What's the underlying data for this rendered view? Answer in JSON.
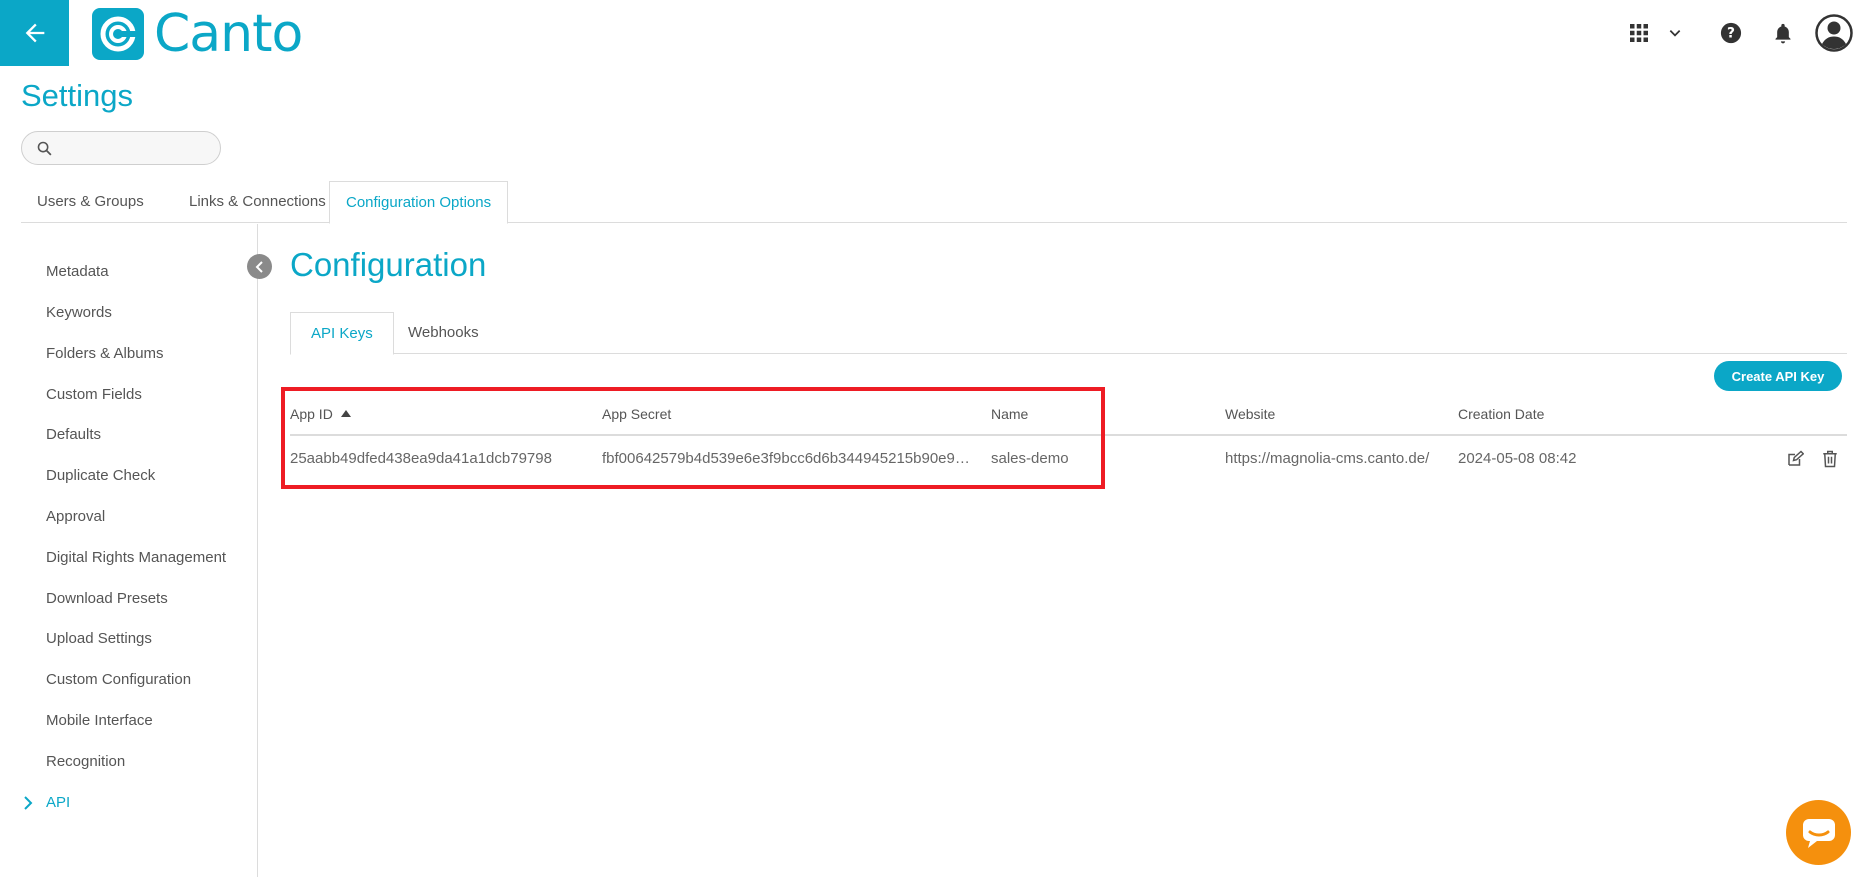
{
  "header": {
    "logo_text": "Canto",
    "brand_color": "#0ba7c7",
    "icons": [
      "arrow-left-icon",
      "apps-grid-icon",
      "chevron-down-icon",
      "help-icon",
      "bell-icon",
      "user-avatar-icon"
    ]
  },
  "page": {
    "title": "Settings",
    "search_placeholder": ""
  },
  "main_tabs": [
    {
      "label": "Users & Groups",
      "active": false
    },
    {
      "label": "Links & Connections",
      "active": false
    },
    {
      "label": "Configuration Options",
      "active": true
    }
  ],
  "sidebar": {
    "items": [
      {
        "label": "Metadata"
      },
      {
        "label": "Keywords"
      },
      {
        "label": "Folders & Albums"
      },
      {
        "label": "Custom Fields"
      },
      {
        "label": "Defaults"
      },
      {
        "label": "Duplicate Check"
      },
      {
        "label": "Approval"
      },
      {
        "label": "Digital Rights Management"
      },
      {
        "label": "Download Presets"
      },
      {
        "label": "Upload Settings"
      },
      {
        "label": "Custom Configuration"
      },
      {
        "label": "Mobile Interface"
      },
      {
        "label": "Recognition"
      },
      {
        "label": "API",
        "active": true
      }
    ]
  },
  "content": {
    "title": "Configuration",
    "tabs": [
      {
        "label": "API Keys",
        "active": true
      },
      {
        "label": "Webhooks",
        "active": false
      }
    ],
    "create_button": "Create API Key",
    "table": {
      "headers": {
        "app_id": "App ID",
        "app_secret": "App Secret",
        "name": "Name",
        "website": "Website",
        "creation_date": "Creation Date"
      },
      "sort": {
        "column": "App ID",
        "direction": "ascending"
      },
      "rows": [
        {
          "app_id": "25aabb49dfed438ea9da41a1dcb79798",
          "app_secret": "fbf00642579b4d539e6e3f9bcc6d6b344945215b90e9…",
          "name": "sales-demo",
          "website": "https://magnolia-cms.canto.de/",
          "creation_date": "2024-05-08 08:42"
        }
      ]
    }
  },
  "colors": {
    "accent": "#0ba7c7",
    "highlight": "#ee1c24",
    "chat": "#f5900d"
  }
}
